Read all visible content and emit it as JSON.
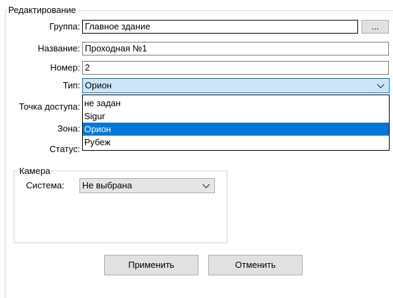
{
  "edit_group": {
    "title": "Редактирование",
    "group_label": "Группа:",
    "group_value": "Главное здание",
    "browse_label": "...",
    "name_label": "Название:",
    "name_value": "Проходная №1",
    "number_label": "Номер:",
    "number_value": "2",
    "type_label": "Тип:",
    "type_value": "Орион",
    "access_point_label": "Точка доступа:",
    "zone_label": "Зона:",
    "status_label": "Статус:"
  },
  "type_dropdown": {
    "options": [
      "не задан",
      "Sigur",
      "Орион",
      "Рубеж"
    ],
    "selected_index": 2
  },
  "camera_group": {
    "title": "Камера",
    "system_label": "Система:",
    "system_value": "Не выбрана"
  },
  "buttons": {
    "apply": "Применить",
    "cancel": "Отменить"
  },
  "colors": {
    "accent": "#0078d7",
    "active_combo_bg": "#cce4f7",
    "button_bg": "#e1e1e1"
  },
  "icons": {
    "type_combo_arrow": "chevron-down-icon",
    "system_combo_arrow": "chevron-down-icon"
  }
}
